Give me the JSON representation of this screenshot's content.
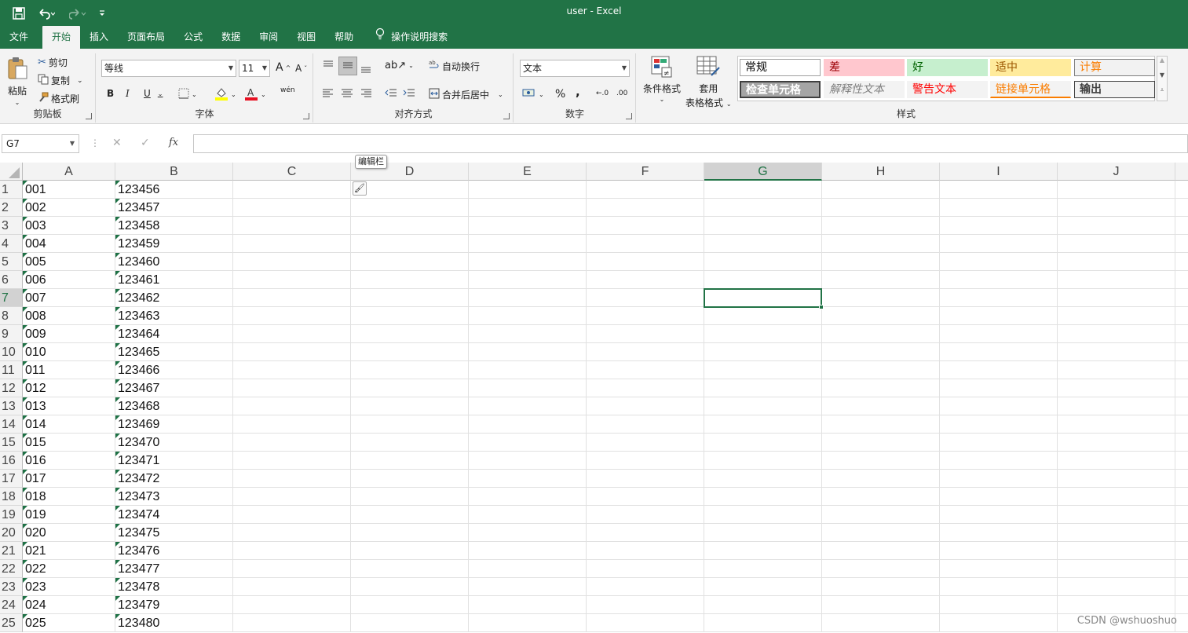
{
  "window": {
    "title": "user  -  Excel"
  },
  "qat": {
    "save_icon": "save-icon",
    "undo_icon": "undo-icon",
    "redo_icon": "redo-icon",
    "customize_icon": "customize-icon"
  },
  "tabs": [
    {
      "label": "文件"
    },
    {
      "label": "开始"
    },
    {
      "label": "插入"
    },
    {
      "label": "页面布局"
    },
    {
      "label": "公式"
    },
    {
      "label": "数据"
    },
    {
      "label": "审阅"
    },
    {
      "label": "视图"
    },
    {
      "label": "帮助"
    },
    {
      "label": "操作说明搜索"
    }
  ],
  "active_tab": "开始",
  "clipboard": {
    "paste": "粘贴",
    "cut": "剪切",
    "copy": "复制",
    "format_painter": "格式刷",
    "group": "剪贴板"
  },
  "font": {
    "name": "等线",
    "size": "11",
    "bold": "B",
    "italic": "I",
    "underline": "U",
    "grow": "A",
    "shrink": "A",
    "phonetic": "wén",
    "group": "字体"
  },
  "alignment": {
    "wrap": "自动换行",
    "merge": "合并后居中",
    "group": "对齐方式"
  },
  "number": {
    "format": "文本",
    "percent": "%",
    "comma": ",",
    "inc_decimal": "←.0",
    "dec_decimal": ".00",
    "group": "数字"
  },
  "styles": {
    "conditional": "条件格式",
    "table_line1": "套用",
    "table_line2": "表格格式",
    "group": "样式",
    "cells": [
      {
        "label": "常规",
        "bg": "#ffffff",
        "color": "#000000",
        "border": "#a0a0a0"
      },
      {
        "label": "差",
        "bg": "#ffc7ce",
        "color": "#9c0006",
        "border": "#ffc7ce"
      },
      {
        "label": "好",
        "bg": "#c6efce",
        "color": "#006100",
        "border": "#c6efce"
      },
      {
        "label": "适中",
        "bg": "#ffeb9c",
        "color": "#9c5700",
        "border": "#ffeb9c"
      },
      {
        "label": "计算",
        "bg": "#f2f2f2",
        "color": "#fa7d00",
        "border": "#7f7f7f"
      },
      {
        "label": "检查单元格",
        "bg": "#a5a5a5",
        "color": "#ffffff",
        "border": "#3f3f3f"
      },
      {
        "label": "解释性文本",
        "bg": "#f3f3f3",
        "color": "#7f7f7f",
        "border": "#f3f3f3"
      },
      {
        "label": "警告文本",
        "bg": "#f3f3f3",
        "color": "#ff0000",
        "border": "#f3f3f3"
      },
      {
        "label": "链接单元格",
        "bg": "#f3f3f3",
        "color": "#fa7d00",
        "border": "#f3f3f3"
      },
      {
        "label": "输出",
        "bg": "#f2f2f2",
        "color": "#3f3f3f",
        "border": "#3f3f3f"
      }
    ]
  },
  "formula_bar": {
    "name_box": "G7",
    "cancel": "✕",
    "enter": "✓",
    "fx": "fx",
    "content": ""
  },
  "tooltip": "编辑栏",
  "columns": [
    "A",
    "B",
    "C",
    "D",
    "E",
    "F",
    "G",
    "H",
    "I",
    "J"
  ],
  "selected_cell": "G7",
  "rows": [
    {
      "n": "1",
      "a": "001",
      "b": "123456"
    },
    {
      "n": "2",
      "a": "002",
      "b": "123457"
    },
    {
      "n": "3",
      "a": "003",
      "b": "123458"
    },
    {
      "n": "4",
      "a": "004",
      "b": "123459"
    },
    {
      "n": "5",
      "a": "005",
      "b": "123460"
    },
    {
      "n": "6",
      "a": "006",
      "b": "123461"
    },
    {
      "n": "7",
      "a": "007",
      "b": "123462"
    },
    {
      "n": "8",
      "a": "008",
      "b": "123463"
    },
    {
      "n": "9",
      "a": "009",
      "b": "123464"
    },
    {
      "n": "10",
      "a": "010",
      "b": "123465"
    },
    {
      "n": "11",
      "a": "011",
      "b": "123466"
    },
    {
      "n": "12",
      "a": "012",
      "b": "123467"
    },
    {
      "n": "13",
      "a": "013",
      "b": "123468"
    },
    {
      "n": "14",
      "a": "014",
      "b": "123469"
    },
    {
      "n": "15",
      "a": "015",
      "b": "123470"
    },
    {
      "n": "16",
      "a": "016",
      "b": "123471"
    },
    {
      "n": "17",
      "a": "017",
      "b": "123472"
    },
    {
      "n": "18",
      "a": "018",
      "b": "123473"
    },
    {
      "n": "19",
      "a": "019",
      "b": "123474"
    },
    {
      "n": "20",
      "a": "020",
      "b": "123475"
    },
    {
      "n": "21",
      "a": "021",
      "b": "123476"
    },
    {
      "n": "22",
      "a": "022",
      "b": "123477"
    },
    {
      "n": "23",
      "a": "023",
      "b": "123478"
    },
    {
      "n": "24",
      "a": "024",
      "b": "123479"
    },
    {
      "n": "25",
      "a": "025",
      "b": "123480"
    }
  ],
  "watermark": "CSDN @wshuoshuo",
  "colors": {
    "accent": "#217346",
    "error_triangle": "#1e7145"
  }
}
